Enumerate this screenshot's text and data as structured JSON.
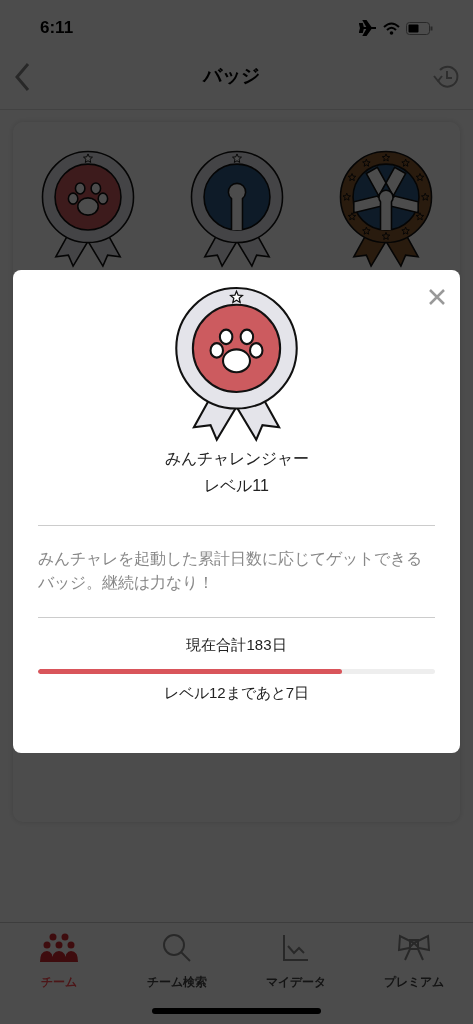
{
  "status_bar": {
    "time": "6:11"
  },
  "nav": {
    "title": "バッジ"
  },
  "badges": [
    {
      "kind": "paw"
    },
    {
      "kind": "arm"
    },
    {
      "kind": "arms"
    }
  ],
  "modal": {
    "kind": "paw",
    "name": "みんチャレンジャー",
    "level_label": "レベル11",
    "description": "みんチャレを起動した累計日数に応じてゲットできるバッジ。継続は力なり！",
    "total": "現在合計183日",
    "progress": {
      "level": 0.766
    },
    "next": "レベル12まであと7日"
  },
  "tabs": [
    {
      "label": "チーム",
      "selected": true
    },
    {
      "label": "チーム検索",
      "selected": false
    },
    {
      "label": "マイデータ",
      "selected": false
    },
    {
      "label": "プレミアム",
      "selected": false
    }
  ]
}
